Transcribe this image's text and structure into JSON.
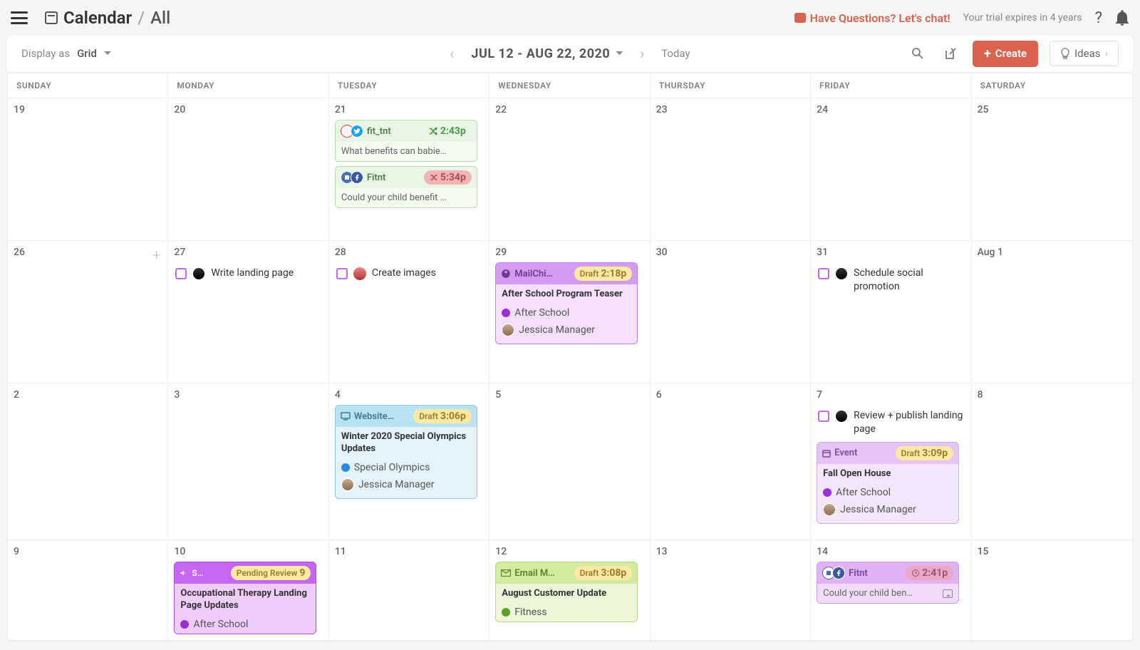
{
  "header": {
    "breadcrumb_main": "Calendar",
    "breadcrumb_sub": "All",
    "chat_text": "Have Questions? Let's chat!",
    "trial_text": "Your trial expires in 4 years"
  },
  "toolbar": {
    "display_as_label": "Display as",
    "display_as_value": "Grid",
    "date_range": "JUL 12 - AUG 22, 2020",
    "today": "Today",
    "create": "Create",
    "ideas": "Ideas"
  },
  "weekdays": [
    "SUNDAY",
    "MONDAY",
    "TUESDAY",
    "WEDNESDAY",
    "THURSDAY",
    "FRIDAY",
    "SATURDAY"
  ],
  "rows": {
    "r1": [
      "19",
      "20",
      "21",
      "22",
      "23",
      "24",
      "25"
    ],
    "r2": [
      "26",
      "27",
      "28",
      "29",
      "30",
      "31",
      "Aug 1"
    ],
    "r3": [
      "2",
      "3",
      "4",
      "5",
      "6",
      "7",
      "8"
    ],
    "r4": [
      "9",
      "10",
      "11",
      "12",
      "13",
      "14",
      "15"
    ]
  },
  "tasks": {
    "t1": "Write landing page",
    "t2": "Create images",
    "t3": "Schedule social promotion",
    "t4": "Review + publish landing page"
  },
  "cards": {
    "fit_tnt": {
      "src": "fit_tnt",
      "time": "2:43p",
      "body": "What benefits can babie…"
    },
    "fitnt1": {
      "src": "Fitnt",
      "time": "5:34p",
      "body": "Could your child benefit …"
    },
    "mailchi": {
      "src": "MailChi…",
      "status": "Draft",
      "time": "2:18p",
      "title": "After School Program Teaser",
      "tag": "After School",
      "author": "Jessica Manager"
    },
    "website": {
      "src": "Website…",
      "status": "Draft",
      "time": "3:06p",
      "title": "Winter 2020 Special Olympics Updates",
      "tag": "Special Olympics",
      "author": "Jessica Manager"
    },
    "event": {
      "src": "Event",
      "status": "Draft",
      "time": "3:09p",
      "title": "Fall Open House",
      "tag": "After School",
      "author": "Jessica Manager"
    },
    "bullhorn": {
      "src": "S…",
      "status": "Pending Review",
      "count": "9",
      "title": "Occupational Therapy Landing Page Updates",
      "tag": "After School"
    },
    "email": {
      "src": "Email M…",
      "status": "Draft",
      "time": "3:08p",
      "title": "August Customer Update",
      "tag": "Fitness"
    },
    "fitnt2": {
      "src": "Fitnt",
      "time": "2:41p",
      "body": "Could your child ben…"
    }
  }
}
